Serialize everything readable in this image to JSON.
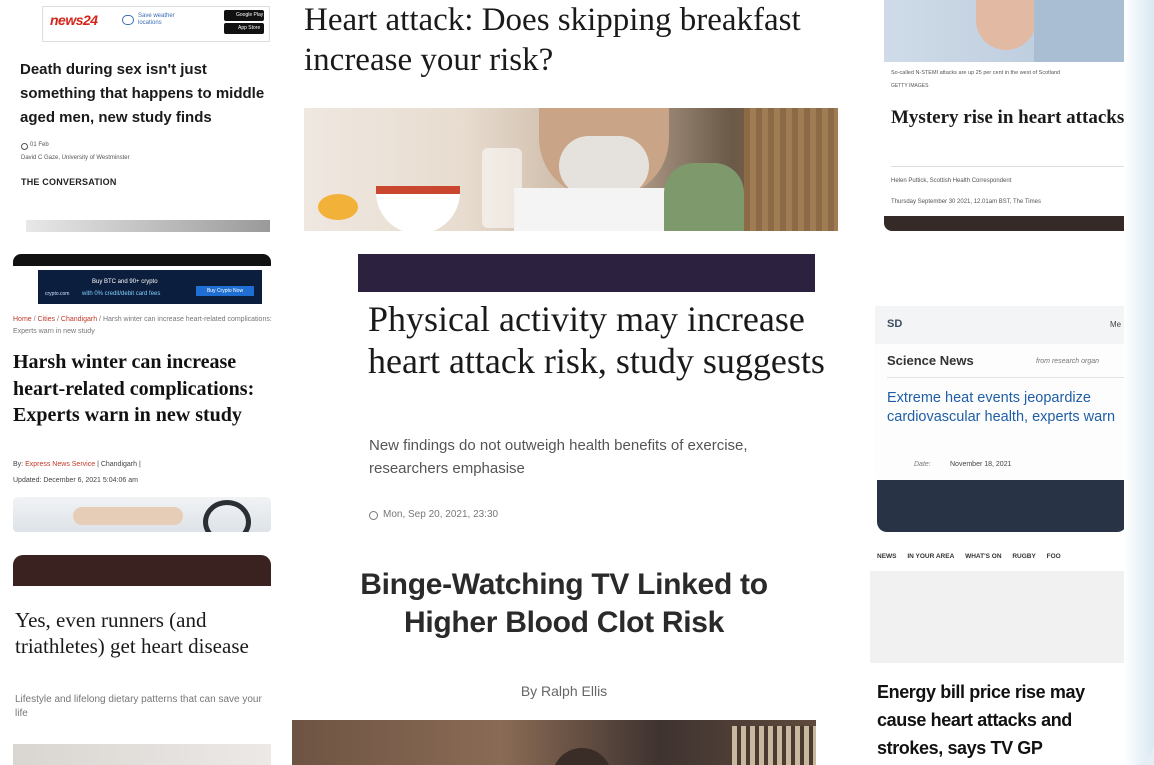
{
  "c1": {
    "news24_logo": "news24",
    "news24_tagline": "Save weather locations",
    "news24_store_1": "Google Play",
    "news24_store_2": "App Store",
    "a1_title": "Death during sex isn't just something that happens to middle aged men, new study finds",
    "a1_date": "01 Feb",
    "a1_author": "David C Gaze, University of Westminster",
    "a1_source": "THE CONVERSATION",
    "ad_text_1": "Buy BTC and 90+ crypto",
    "ad_text_2": "with 0% credit/debit card fees",
    "ad_button": "Buy Crypto Now",
    "ad_brand": "crypto.com",
    "crumb_home": "Home",
    "crumb_cities": "Cities",
    "crumb_city": "Chandigarh",
    "crumb_rest": "Harsh winter can increase heart-related complications: Experts warn in new study",
    "a2_title": "Harsh winter can increase heart-related complications: Experts warn in new study",
    "a2_by": "By:",
    "a2_author": "Express News Service",
    "a2_place": "| Chandigarh |",
    "a2_updated": "Updated: December 6, 2021 5:04:06 am",
    "a3_title": "Yes, even runners (and triathletes) get heart disease",
    "a3_sub": "Lifestyle and lifelong dietary patterns that can save your life"
  },
  "c2": {
    "h1": "Heart attack: Does skipping breakfast increase your risk?",
    "h2_title": "Physical activity may increase heart attack risk, study suggests",
    "h2_sub": "New findings do not outweigh health benefits of exercise, researchers emphasise",
    "h2_date": "Mon, Sep 20, 2021, 23:30",
    "h3_title": "Binge-Watching TV Linked to Higher Blood Clot Risk",
    "h3_by": "By Ralph Ellis"
  },
  "c3": {
    "caption": "So-called N-STEMI attacks are up 25 per cent in the west of Scotland",
    "caption_credit": "GETTY IMAGES",
    "t1_title": "Mystery rise in heart attacks from blocked arteries",
    "t1_author": "Helen Puttick, Scottish Health Correspondent",
    "t1_date": "Thursday September 30 2021, 12.01am BST, The Times",
    "sd_logo": "SD",
    "sd_menu": "Me",
    "sd_section": "Science News",
    "sd_from": "from research organ",
    "sd_title": "Extreme heat events jeopardize cardiovascular health, experts warn",
    "sd_date_label": "Date:",
    "sd_date": "November 18, 2021",
    "nav": [
      "NEWS",
      "IN YOUR AREA",
      "WHAT'S ON",
      "RUGBY",
      "FOO"
    ],
    "e_title": "Energy bill price rise may cause heart attacks and strokes, says TV GP"
  }
}
